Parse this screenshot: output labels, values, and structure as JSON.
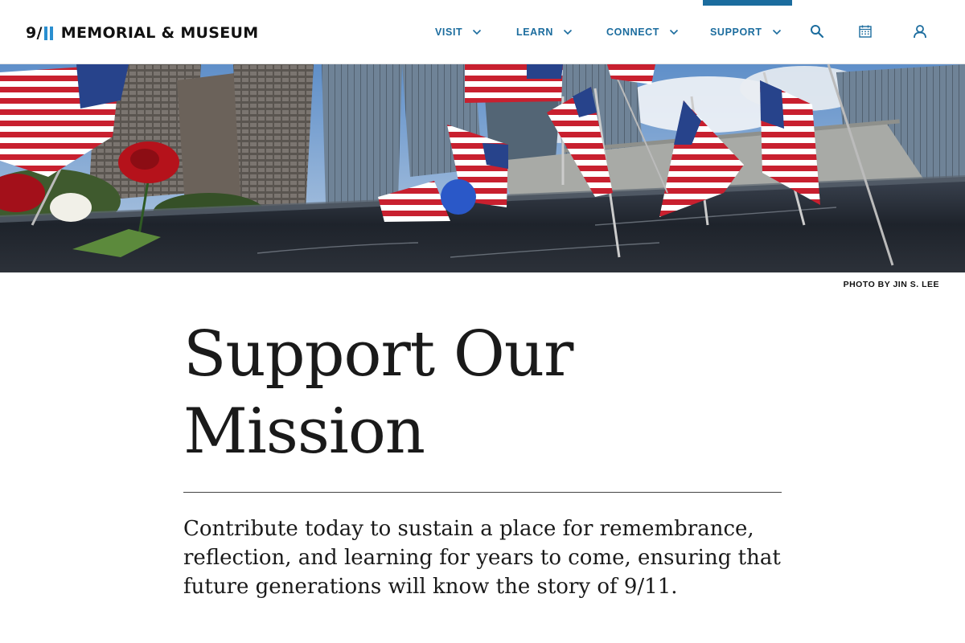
{
  "header": {
    "logo": {
      "number": "9/",
      "text": "MEMORIAL & MUSEUM",
      "accent_color": "#2a8fd0"
    },
    "nav": [
      {
        "label": "VISIT"
      },
      {
        "label": "LEARN"
      },
      {
        "label": "CONNECT"
      },
      {
        "label": "SUPPORT",
        "active": true
      }
    ],
    "icons": [
      "search-icon",
      "calendar-icon",
      "account-icon"
    ],
    "nav_color": "#1b6c9e"
  },
  "hero": {
    "caption": "PHOTO BY JIN S. LEE"
  },
  "main": {
    "title_line1": "Support Our",
    "title_line2": "Mission",
    "lead": "Contribute today to sustain a place for remembrance, reflection, and learning for years to come, ensuring that future generations will know the story of 9/11."
  }
}
